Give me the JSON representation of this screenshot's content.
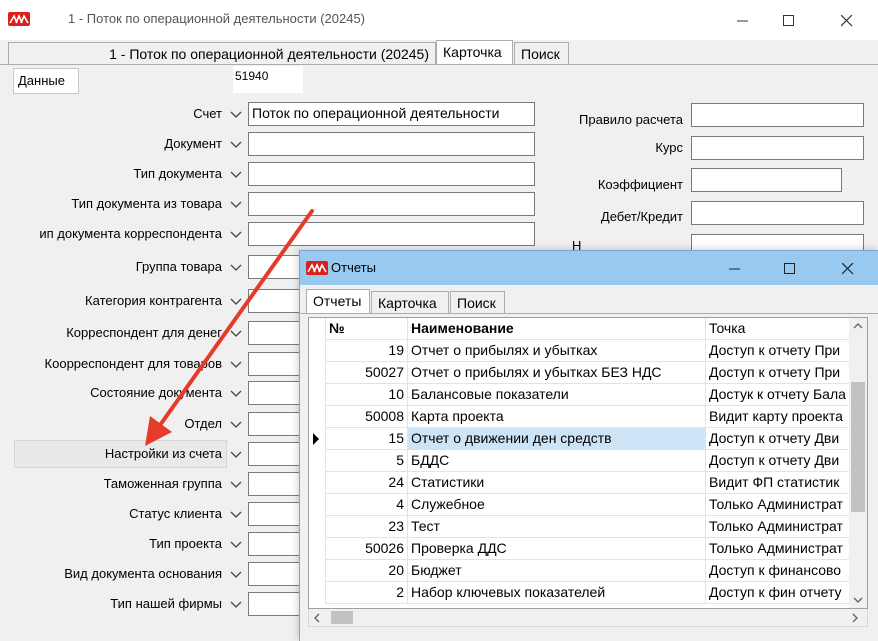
{
  "main_window": {
    "title": "1 - Поток по операционной деятельности (20245)",
    "tabs": [
      {
        "label": "1 - Поток по операционной деятельности (20245)"
      },
      {
        "label": "Карточка"
      },
      {
        "label": "Поиск"
      }
    ],
    "active_tab": 1,
    "subtab_label": "Данные",
    "record_id": "51940",
    "left_fields": [
      {
        "label": "Счет",
        "value": "Поток по операционной деятельности"
      },
      {
        "label": "Документ",
        "value": ""
      },
      {
        "label": "Тип документа",
        "value": ""
      },
      {
        "label": "Тип документа из товара",
        "value": ""
      },
      {
        "label": "ип документа корреспондента",
        "value": ""
      },
      {
        "label": "Группа товара",
        "value": ""
      },
      {
        "label": "Категория контрагента",
        "value": ""
      },
      {
        "label": "Корреспондент для денег",
        "value": ""
      },
      {
        "label": "Коорреспондент для товаров",
        "value": ""
      },
      {
        "label": "Состояние документа",
        "value": ""
      },
      {
        "label": "Отдел",
        "value": ""
      },
      {
        "label": "Настройки из счета",
        "value": ""
      },
      {
        "label": "Таможенная группа",
        "value": ""
      },
      {
        "label": "Статус клиента",
        "value": ""
      },
      {
        "label": "Тип проекта",
        "value": ""
      },
      {
        "label": "Вид документа основания",
        "value": ""
      },
      {
        "label": "Тип нашей фирмы",
        "value": ""
      }
    ],
    "right_fields": [
      {
        "label": "Правило расчета",
        "value": ""
      },
      {
        "label": "Курс",
        "value": ""
      },
      {
        "label": "Коэффициент",
        "value": ""
      },
      {
        "label": "Дебет/Кредит",
        "value": ""
      },
      {
        "label": "Н",
        "value": ""
      }
    ]
  },
  "reports_window": {
    "title": "Отчеты",
    "tabs": [
      {
        "label": "Отчеты"
      },
      {
        "label": "Карточка"
      },
      {
        "label": "Поиск"
      }
    ],
    "active_tab": 0,
    "columns": [
      "№",
      "Наименование",
      "Точка"
    ],
    "rows": [
      {
        "num": "19",
        "name": "Отчет о прибылях и убытках",
        "point": "Доступ к отчету При"
      },
      {
        "num": "50027",
        "name": "Отчет о прибылях и убытках БЕЗ НДС",
        "point": "Доступ к отчету При"
      },
      {
        "num": "10",
        "name": "Балансовые показатели",
        "point": "Достук к отчету Бала"
      },
      {
        "num": "50008",
        "name": "Карта проекта",
        "point": "Видит карту проекта"
      },
      {
        "num": "15",
        "name": "Отчет о движении ден средств",
        "point": "Доступ к отчету Дви"
      },
      {
        "num": "5",
        "name": "БДДС",
        "point": "Доступ к отчету Дви"
      },
      {
        "num": "24",
        "name": "Статистики",
        "point": "Видит ФП статистик"
      },
      {
        "num": "4",
        "name": "Служебное",
        "point": "Только Администрат"
      },
      {
        "num": "23",
        "name": "Тест",
        "point": "Только Администрат"
      },
      {
        "num": "50026",
        "name": "Проверка ДДС",
        "point": "Только Администрат"
      },
      {
        "num": "20",
        "name": "Бюджет",
        "point": "Доступ к финансово"
      },
      {
        "num": "2",
        "name": "Набор ключевых показателей",
        "point": "Доступ к фин отчету"
      }
    ],
    "selected_row": 4
  },
  "colors": {
    "annotation_arrow": "#e53b2c",
    "child_titlebar": "#99c9ef",
    "selection": "#cde4f7"
  }
}
